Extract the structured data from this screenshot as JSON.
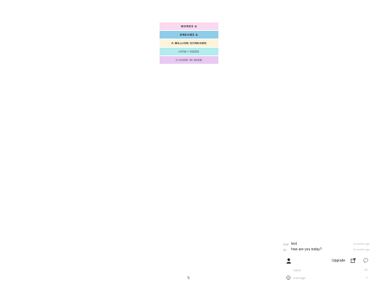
{
  "menu": {
    "items": [
      {
        "label": "WORDS &",
        "color": "#fbd9ef"
      },
      {
        "label": "DREAMS &",
        "color": "#8ecde9"
      },
      {
        "label": "A MILLION SCREAMS",
        "color": "#fdf3d9"
      },
      {
        "label": "HOW I NEED",
        "color": "#b3ebee"
      },
      {
        "label": "A HAND IN MINE",
        "color": "#e9c9f4"
      }
    ]
  },
  "chat": {
    "messages": [
      {
        "user": "test",
        "text": "test",
        "time": "14 months ago"
      },
      {
        "user": "tic",
        "text": "how are you today?",
        "time": "14 months ago"
      }
    ],
    "toolbar": {
      "upgrade_label": "Upgrade",
      "icons": [
        "user-icon",
        "popout-icon",
        "chat-bubble-icon"
      ]
    },
    "name_field": {
      "placeholder": "name",
      "count": "45"
    },
    "message_field": {
      "placeholder": "message",
      "count": "4"
    }
  },
  "footer": {
    "page_number": "5"
  }
}
